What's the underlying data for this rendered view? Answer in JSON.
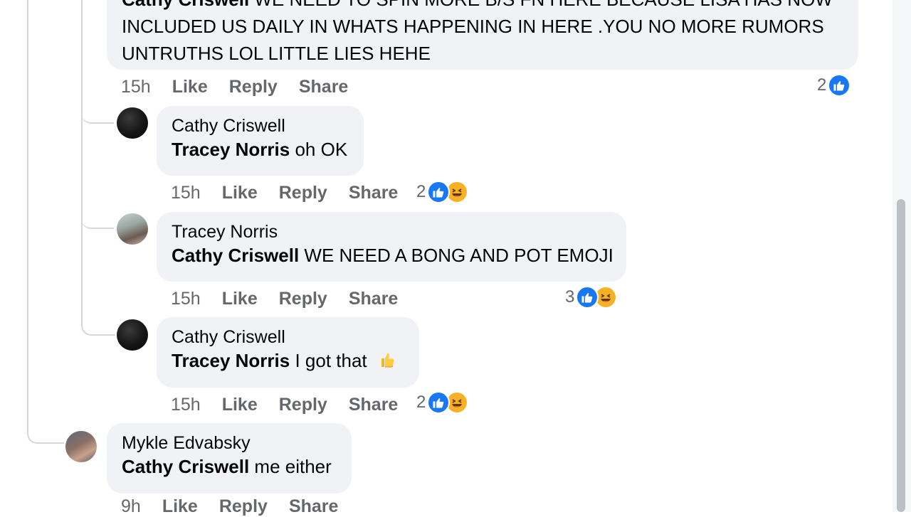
{
  "top_comment": {
    "author_tag": "Cathy Criswell",
    "text_line1": "WE NEED TO SPIN MORE B/S FN HERE BECAUSE LISA HAS NOW",
    "text_line2": "INCLUDED US DAILY IN WHATS HAPPENING IN HERE .YOU NO MORE RUMORS",
    "text_line3": "UNTRUTHS LOL LITTLE LIES HEHE",
    "time": "15h",
    "like": "Like",
    "reply": "Reply",
    "share": "Share",
    "reaction_count": "2"
  },
  "replies": [
    {
      "author": "Cathy Criswell",
      "tag": "Tracey Norris",
      "text": "oh OK",
      "time": "15h",
      "like": "Like",
      "reply": "Reply",
      "share": "Share",
      "reaction_count": "2"
    },
    {
      "author": "Tracey Norris",
      "tag": "Cathy Criswell",
      "text": "WE NEED A BONG AND POT EMOJI",
      "time": "15h",
      "like": "Like",
      "reply": "Reply",
      "share": "Share",
      "reaction_count": "3"
    },
    {
      "author": "Cathy Criswell",
      "tag": "Tracey Norris",
      "text": "I got that",
      "time": "15h",
      "like": "Like",
      "reply": "Reply",
      "share": "Share",
      "reaction_count": "2"
    }
  ],
  "last_comment": {
    "author": "Mykle Edvabsky",
    "tag": "Cathy Criswell",
    "text": "me either",
    "time": "9h",
    "like": "Like",
    "reply": "Reply",
    "share": "Share"
  },
  "icons": {
    "like_reaction": "like-reaction-icon",
    "haha_reaction": "haha-reaction-icon",
    "thumbs_up_emoji": "thumbs-up-emoji-icon"
  },
  "colors": {
    "bubble": "#f0f2f5",
    "like_blue": "#1877f2",
    "haha_yellow": "#f7b125",
    "meta_gray": "#65676b"
  }
}
